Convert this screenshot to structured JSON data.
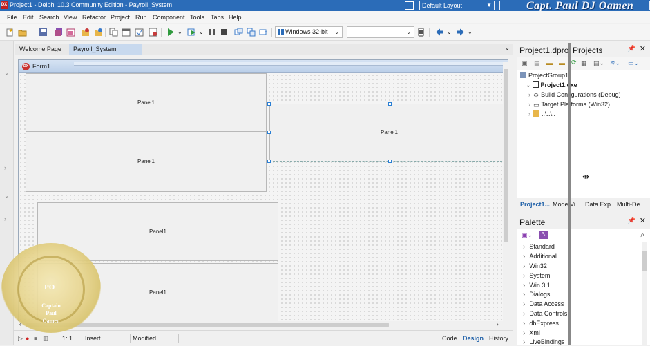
{
  "window": {
    "app_icon": "DX",
    "title": "Project1 - Delphi 10.3 Community Edition - Payroll_System",
    "layout_selected": "Default Layout",
    "watermark_top": "Capt. Paul DJ Oamen"
  },
  "menu": [
    "File",
    "Edit",
    "Search",
    "View",
    "Refactor",
    "Project",
    "Run",
    "Component",
    "Tools",
    "Tabs",
    "Help"
  ],
  "toolbar": {
    "platform": "Windows 32-bit",
    "config_value": ""
  },
  "editor_tabs": [
    "Welcome Page",
    "Payroll_System"
  ],
  "form": {
    "icon": "DX",
    "title": "Form1",
    "panels": [
      "Panel1",
      "Panel1",
      "Panel1",
      "Panel1",
      "Panel1",
      "Panel1"
    ]
  },
  "statusbar": {
    "position": "1: 1",
    "mode": "Insert",
    "state": "Modified",
    "tabs": [
      "Code",
      "Design",
      "History"
    ]
  },
  "project_pane": {
    "title_left": "Project1.dproj",
    "title_right": "Projects",
    "tree": {
      "group": "ProjectGroup1",
      "project": "Project1.exe",
      "build": "Build Configurations (Debug)",
      "target": "Target Platforms (Win32)",
      "folder": "..\\..\\.."
    },
    "bottom_tabs": [
      "Project1...",
      "Mode...",
      "Vi...",
      "Data Exp...",
      "Multi-De..."
    ]
  },
  "palette": {
    "title": "Palette",
    "categories": [
      "Standard",
      "Additional",
      "Win32",
      "System",
      "Win 3.1",
      "Dialogs",
      "Data Access",
      "Data Controls",
      "dbExpress",
      "Xml",
      "LiveBindings"
    ]
  },
  "logo": {
    "initials": "PO",
    "line1": "Captain",
    "line2": "Paul",
    "line3": "Oamen"
  },
  "colors": {
    "titlebar": "#2b6cb8",
    "active_tab": "#c8d9ee",
    "selection_handle": "#2a7fd4"
  }
}
